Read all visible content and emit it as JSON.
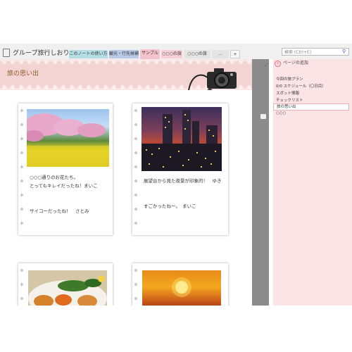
{
  "notebook": {
    "title": "グループ旅行しおり"
  },
  "tabs": [
    {
      "label": "このノートの使い方"
    },
    {
      "label": "観光・行先候補"
    },
    {
      "label": "サンプル"
    },
    {
      "label": "○○○の旅"
    },
    {
      "label": "○○○の旅"
    },
    {
      "label": "..."
    },
    {
      "label": "+"
    }
  ],
  "search": {
    "placeholder": "検索 (Ctrl+E)"
  },
  "page": {
    "title": "旅の思い出"
  },
  "cards": [
    {
      "caption": "○○○通りのお花たち。\nとってもキレイだったね！まいこ\n\n\nサイコーだったね！　さとみ"
    },
    {
      "caption": "展望台から見た夜景が印象的！　ゆき\n\n\nすごかったねー。　まいこ"
    },
    {
      "caption": ""
    },
    {
      "caption": ""
    }
  ],
  "panel": {
    "add_page": "ページの追加",
    "pages": [
      {
        "label": "今回の旅プラン"
      },
      {
        "label": "0/0 スケジュール（〇日目）"
      },
      {
        "label": "スポット情報"
      },
      {
        "label": "チェックリスト"
      },
      {
        "label": "旅の思い出"
      },
      {
        "label": "○○○"
      }
    ]
  },
  "colors": {
    "accent": "#e06a7a",
    "banner": "#f4d3d3",
    "panel": "#fce4e6"
  }
}
